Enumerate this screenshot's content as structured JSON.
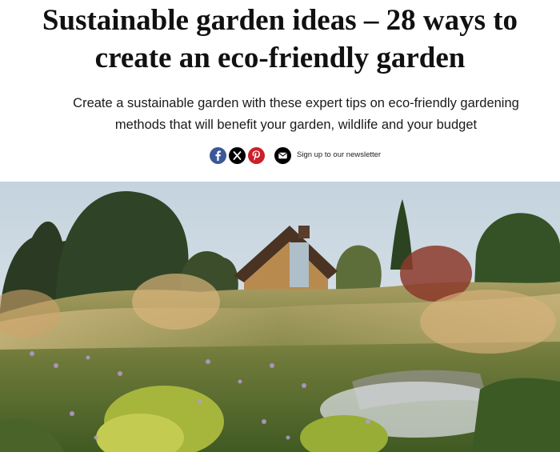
{
  "article": {
    "title_line1": "Sustainable garden ideas – 28 ways to",
    "title_line2": "create an eco-friendly garden",
    "subtitle_line1": "Create a sustainable garden with these expert tips on eco-friendly gardening",
    "subtitle_line2": "methods that will benefit your garden, wildlife and your budget"
  },
  "share": {
    "icons": [
      "facebook-icon",
      "x-icon",
      "pinterest-icon",
      "mail-icon"
    ],
    "colors": {
      "facebook": "#3b5998",
      "x": "#000000",
      "pinterest": "#cb2027",
      "mail": "#000000"
    },
    "newsletter_label": "Sign up to our newsletter"
  }
}
